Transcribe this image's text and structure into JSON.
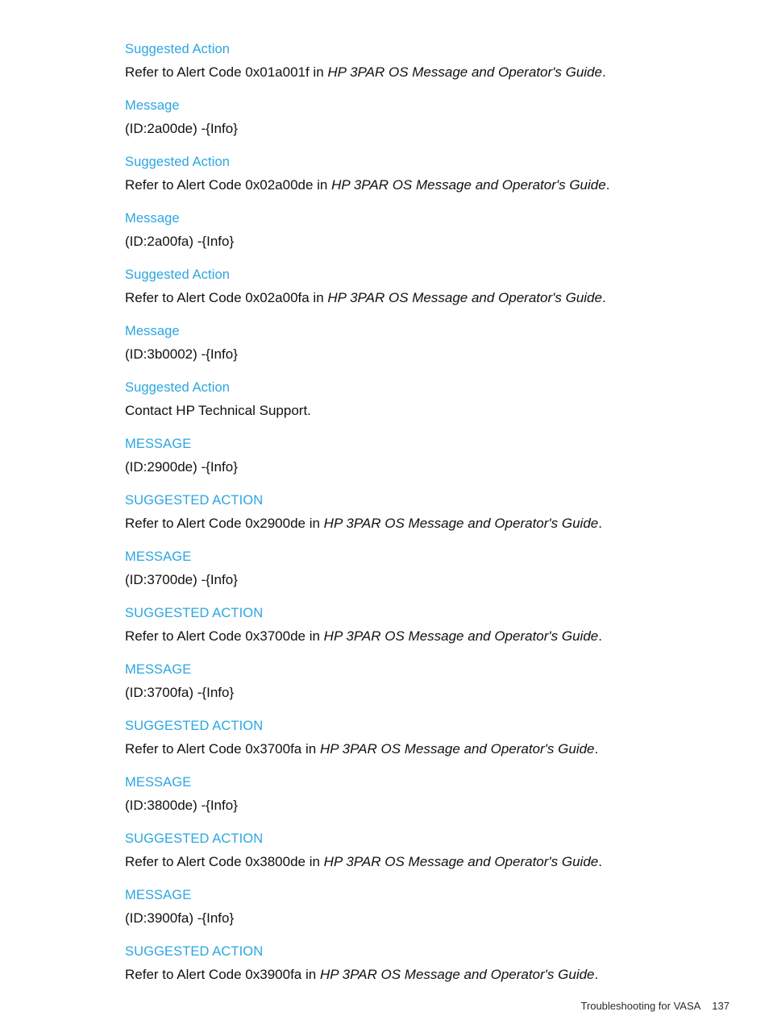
{
  "page": {
    "background_color": "#ffffff",
    "heading_color": "#2ba6e0",
    "body_color": "#111111"
  },
  "blocks": [
    {
      "heading": "Suggested Action",
      "body_prefix": "Refer to Alert Code 0x01a001f in ",
      "body_italic": "HP 3PAR OS Message and Operator's Guide",
      "body_suffix": "."
    },
    {
      "heading": "Message",
      "body_prefix": "(ID:2a00de) -{Info}",
      "body_italic": "",
      "body_suffix": ""
    },
    {
      "heading": "Suggested Action",
      "body_prefix": "Refer to Alert Code 0x02a00de in ",
      "body_italic": "HP 3PAR OS Message and Operator's Guide",
      "body_suffix": "."
    },
    {
      "heading": "Message",
      "body_prefix": "(ID:2a00fa) -{Info}",
      "body_italic": "",
      "body_suffix": ""
    },
    {
      "heading": "Suggested Action",
      "body_prefix": "Refer to Alert Code 0x02a00fa in ",
      "body_italic": "HP 3PAR OS Message and Operator's Guide",
      "body_suffix": "."
    },
    {
      "heading": "Message",
      "body_prefix": "(ID:3b0002) -{Info}",
      "body_italic": "",
      "body_suffix": ""
    },
    {
      "heading": "Suggested Action",
      "body_prefix": "Contact HP Technical Support.",
      "body_italic": "",
      "body_suffix": ""
    },
    {
      "heading": "MESSAGE",
      "body_prefix": "(ID:2900de) -{Info}",
      "body_italic": "",
      "body_suffix": ""
    },
    {
      "heading": "SUGGESTED ACTION",
      "body_prefix": "Refer to Alert Code 0x2900de in ",
      "body_italic": "HP 3PAR OS Message and Operator's Guide",
      "body_suffix": "."
    },
    {
      "heading": "MESSAGE",
      "body_prefix": "(ID:3700de) -{Info}",
      "body_italic": "",
      "body_suffix": ""
    },
    {
      "heading": "SUGGESTED ACTION",
      "body_prefix": "Refer to Alert Code 0x3700de in ",
      "body_italic": "HP 3PAR OS Message and Operator's Guide",
      "body_suffix": "."
    },
    {
      "heading": "MESSAGE",
      "body_prefix": "(ID:3700fa) -{Info}",
      "body_italic": "",
      "body_suffix": ""
    },
    {
      "heading": "SUGGESTED ACTION",
      "body_prefix": "Refer to Alert Code 0x3700fa in ",
      "body_italic": "HP 3PAR OS Message and Operator's Guide",
      "body_suffix": "."
    },
    {
      "heading": "MESSAGE",
      "body_prefix": "(ID:3800de) -{Info}",
      "body_italic": "",
      "body_suffix": ""
    },
    {
      "heading": "SUGGESTED ACTION",
      "body_prefix": "Refer to Alert Code 0x3800de in ",
      "body_italic": "HP 3PAR OS Message and Operator's Guide",
      "body_suffix": "."
    },
    {
      "heading": "MESSAGE",
      "body_prefix": "(ID:3900fa) -{Info}",
      "body_italic": "",
      "body_suffix": ""
    },
    {
      "heading": "SUGGESTED ACTION",
      "body_prefix": "Refer to Alert Code 0x3900fa in ",
      "body_italic": "HP 3PAR OS Message and Operator's Guide",
      "body_suffix": "."
    }
  ],
  "footer": {
    "chapter": "Troubleshooting for VASA",
    "page_number": "137"
  }
}
